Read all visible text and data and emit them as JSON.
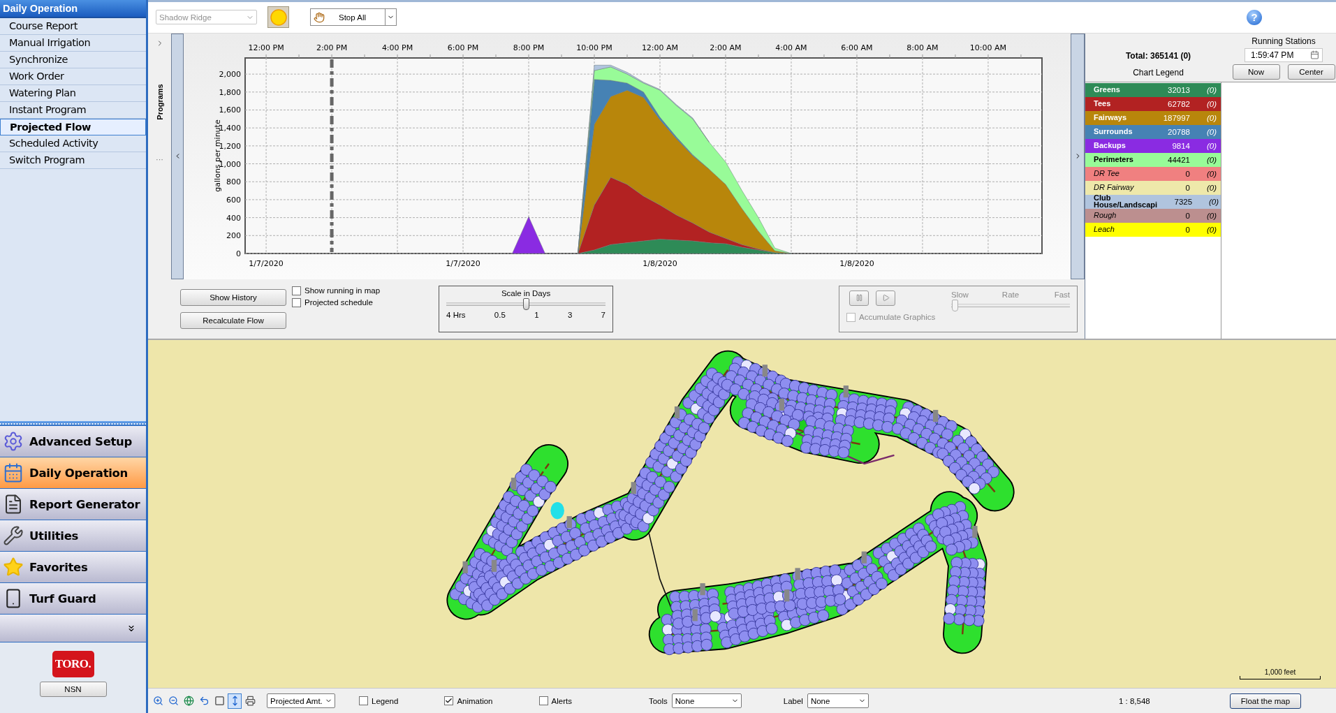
{
  "sidebar": {
    "title": "Daily Operation",
    "items": [
      {
        "label": "Course Report",
        "selected": false
      },
      {
        "label": "Manual Irrigation",
        "selected": false
      },
      {
        "label": "Synchronize",
        "selected": false
      },
      {
        "label": "Work Order",
        "selected": false
      },
      {
        "label": "Watering Plan",
        "selected": false
      },
      {
        "label": "Instant Program",
        "selected": false
      },
      {
        "label": "Projected Flow",
        "selected": true
      },
      {
        "label": "Scheduled Activity",
        "selected": false
      },
      {
        "label": "Switch Program",
        "selected": false
      }
    ],
    "nav": [
      {
        "label": "Advanced Setup",
        "kind": "gear",
        "selected": false
      },
      {
        "label": "Daily Operation",
        "kind": "calendar",
        "selected": true
      },
      {
        "label": "Report Generator",
        "kind": "report",
        "selected": false
      },
      {
        "label": "Utilities",
        "kind": "tools",
        "selected": false
      },
      {
        "label": "Favorites",
        "kind": "star",
        "selected": false
      },
      {
        "label": "Turf Guard",
        "kind": "device",
        "selected": false
      }
    ],
    "logo": "TORO.",
    "user_button": "NSN"
  },
  "toolbar": {
    "course": {
      "value": "Shadow Ridge",
      "disabled": true
    },
    "stop_button": "Stop All",
    "help": "?"
  },
  "programs_panel": {
    "title": "Programs",
    "more": "···"
  },
  "chart": {
    "date_labels": [
      "1/7/2020",
      "1/7/2020",
      "1/8/2020",
      "1/8/2020"
    ],
    "chart_data": {
      "type": "area",
      "stacked": true,
      "ylabel": "gallons per minute",
      "categories": [
        null,
        "12:00 PM",
        null,
        null,
        null,
        "2:00 PM",
        null,
        null,
        null,
        "4:00 PM",
        null,
        null,
        null,
        "6:00 PM",
        null,
        null,
        null,
        "8:00 PM",
        null,
        null,
        null,
        "10:00 PM",
        null,
        null,
        null,
        "12:00 AM",
        null,
        null,
        null,
        "2:00 AM",
        null,
        null,
        null,
        "4:00 AM",
        null,
        null,
        null,
        "6:00 AM",
        null,
        null,
        null,
        "8:00 AM",
        null,
        null,
        null,
        "10:00 AM",
        null,
        null,
        null
      ],
      "series": [
        {
          "color": "#2e8b57",
          "values": [
            null,
            null,
            null,
            null,
            null,
            null,
            null,
            null,
            null,
            null,
            null,
            null,
            null,
            null,
            null,
            null,
            null,
            null,
            null,
            null,
            0,
            40,
            100,
            120,
            140,
            160,
            150,
            140,
            120,
            110,
            70,
            40,
            10,
            0,
            null,
            null,
            null,
            null,
            null,
            null,
            null,
            null,
            null,
            null,
            null,
            null,
            null,
            null,
            null
          ]
        },
        {
          "color": "#b22222",
          "values": [
            null,
            null,
            null,
            null,
            null,
            null,
            null,
            null,
            null,
            null,
            null,
            null,
            null,
            null,
            null,
            null,
            null,
            null,
            null,
            null,
            0,
            500,
            750,
            650,
            500,
            380,
            280,
            200,
            120,
            60,
            30,
            10,
            0,
            null,
            null,
            null,
            null,
            null,
            null,
            null,
            null,
            null,
            null,
            null,
            null,
            null,
            null,
            null,
            null
          ]
        },
        {
          "color": "#b8860b",
          "values": [
            null,
            null,
            null,
            null,
            null,
            null,
            null,
            null,
            null,
            null,
            null,
            null,
            null,
            null,
            null,
            null,
            null,
            null,
            null,
            null,
            0,
            900,
            900,
            1050,
            1100,
            950,
            850,
            750,
            700,
            600,
            400,
            200,
            20,
            0,
            null,
            null,
            null,
            null,
            null,
            null,
            null,
            null,
            null,
            null,
            null,
            null,
            null,
            null,
            null
          ]
        },
        {
          "color": "#4682b4",
          "values": [
            null,
            null,
            null,
            null,
            null,
            null,
            null,
            null,
            null,
            null,
            null,
            null,
            null,
            null,
            null,
            null,
            null,
            null,
            null,
            null,
            0,
            500,
            180,
            80,
            60,
            30,
            20,
            10,
            0,
            null,
            null,
            null,
            null,
            null,
            null,
            null,
            null,
            null,
            null,
            null,
            null,
            null,
            null,
            null,
            null,
            null,
            null,
            null,
            null
          ]
        },
        {
          "color": "#8a2be2",
          "values": [
            null,
            null,
            null,
            null,
            null,
            null,
            null,
            null,
            null,
            null,
            null,
            null,
            null,
            null,
            null,
            null,
            0,
            410,
            0,
            null,
            null,
            null,
            null,
            null,
            null,
            null,
            null,
            null,
            null,
            null,
            null,
            null,
            null,
            null,
            null,
            null,
            null,
            null,
            null,
            null,
            null,
            null,
            null,
            null,
            null,
            null,
            null,
            null,
            null
          ]
        },
        {
          "color": "#98fb98",
          "values": [
            null,
            null,
            null,
            null,
            null,
            null,
            null,
            null,
            null,
            null,
            null,
            null,
            null,
            null,
            null,
            null,
            null,
            null,
            null,
            null,
            0,
            100,
            150,
            100,
            100,
            300,
            350,
            400,
            300,
            250,
            200,
            150,
            30,
            0,
            null,
            null,
            null,
            null,
            null,
            null,
            null,
            null,
            null,
            null,
            null,
            null,
            null,
            null,
            null
          ]
        },
        {
          "color": "#b0c4de",
          "values": [
            null,
            null,
            null,
            null,
            null,
            null,
            null,
            null,
            null,
            null,
            null,
            null,
            null,
            null,
            null,
            null,
            null,
            null,
            null,
            null,
            0,
            60,
            20,
            20,
            10,
            10,
            10,
            10,
            0,
            null,
            null,
            null,
            null,
            null,
            null,
            null,
            null,
            null,
            null,
            null,
            null,
            null,
            null,
            null,
            null,
            null,
            null,
            null,
            null
          ]
        }
      ],
      "ylim": [
        0,
        2180
      ],
      "yticks": [
        {
          "value": 0,
          "label": "0"
        },
        {
          "value": 200,
          "label": "200"
        },
        {
          "value": 400,
          "label": "400"
        },
        {
          "value": 600,
          "label": "600"
        },
        {
          "value": 800,
          "label": "800"
        },
        {
          "value": 1000,
          "label": "1,000"
        },
        {
          "value": 1200,
          "label": "1,200"
        },
        {
          "value": 1400,
          "label": "1,400"
        },
        {
          "value": 1600,
          "label": "1,600"
        },
        {
          "value": 1800,
          "label": "1,800"
        },
        {
          "value": 2000,
          "label": "2,000"
        }
      ],
      "grid": true,
      "ref_lines": [
        {
          "axis": "x",
          "value": "2:00 PM"
        }
      ]
    }
  },
  "legend_panel": {
    "total": "Total: 365141 (0)",
    "title": "Chart Legend",
    "running_stations": "Running Stations",
    "time": "1:59:47 PM",
    "buttons": [
      "Now",
      "Center"
    ],
    "rows": [
      {
        "name": "Greens",
        "value": "32013",
        "count": "(0)",
        "color": "#2e8b57",
        "active": true
      },
      {
        "name": "Tees",
        "value": "62782",
        "count": "(0)",
        "color": "#b22222",
        "active": true
      },
      {
        "name": "Fairways",
        "value": "187997",
        "count": "(0)",
        "color": "#b8860b",
        "active": true
      },
      {
        "name": "Surrounds",
        "value": "20788",
        "count": "(0)",
        "color": "#4682b4",
        "active": true
      },
      {
        "name": "Backups",
        "value": "9814",
        "count": "(0)",
        "color": "#8a2be2",
        "active": true
      },
      {
        "name": "Perimeters",
        "value": "44421",
        "count": "(0)",
        "color": "#98fb98",
        "active": true
      },
      {
        "name": "DR Tee",
        "value": "0",
        "count": "(0)",
        "color": "#f08080",
        "active": false
      },
      {
        "name": "DR Fairway",
        "value": "0",
        "count": "(0)",
        "color": "#eee8aa",
        "active": false
      },
      {
        "name": "Club House/Landscapi",
        "value": "7325",
        "count": "(0)",
        "color": "#b0c4de",
        "active": true
      },
      {
        "name": "Rough",
        "value": "0",
        "count": "(0)",
        "color": "#bc8f8f",
        "active": false
      },
      {
        "name": "Leach",
        "value": "0",
        "count": "(0)",
        "color": "#ffff00",
        "active": false
      }
    ]
  },
  "controls": {
    "buttons": [
      "Show History",
      "Recalculate Flow"
    ],
    "checkboxes": [
      {
        "label": "Show running in map",
        "checked": false
      },
      {
        "label": "Projected schedule",
        "checked": false
      }
    ],
    "scale": {
      "title": "Scale in Days",
      "labels": [
        "4 Hrs",
        "0.5",
        "1",
        "3",
        "7"
      ],
      "level": 0.5
    },
    "playback": {
      "disabled": true,
      "accumulate": {
        "label": "Accumulate Graphics",
        "checked": false
      },
      "rate": {
        "title": "Rate",
        "min": "Slow",
        "max": "Fast",
        "level": 0
      }
    }
  },
  "map": {
    "scale_bar": "1,000 feet"
  },
  "map_toolbar": {
    "tools": [
      {
        "kind": "zoom-in",
        "selected": false
      },
      {
        "kind": "zoom-out",
        "selected": false
      },
      {
        "kind": "globe",
        "selected": false
      },
      {
        "kind": "undo",
        "selected": false
      },
      {
        "kind": "square",
        "selected": false
      },
      {
        "kind": "pan",
        "selected": true
      },
      {
        "kind": "print",
        "selected": false
      }
    ],
    "layer": "Projected Amt.",
    "checkboxes": [
      {
        "label": "Legend",
        "checked": false
      },
      {
        "label": "Animation",
        "checked": true
      },
      {
        "label": "Alerts",
        "checked": false
      }
    ],
    "tools_select": {
      "label": "Tools",
      "value": "None"
    },
    "label_select": {
      "label": "Label",
      "value": "None"
    },
    "scale": "1 : 8,548",
    "float_button": "Float the map"
  }
}
